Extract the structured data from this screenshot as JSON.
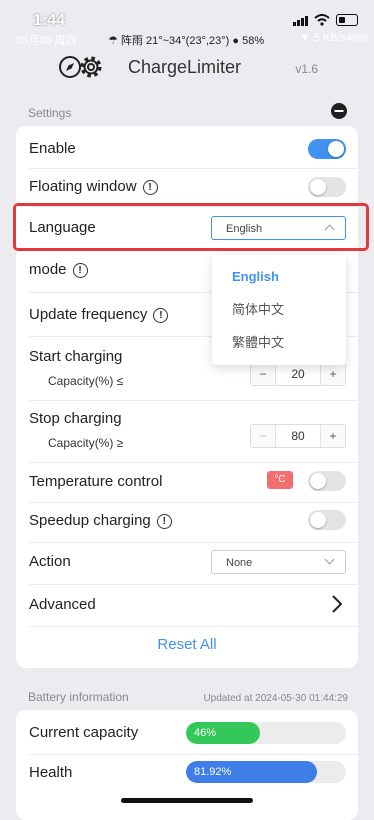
{
  "status_bar": {
    "time": "1:44",
    "date": "05月30 周四",
    "weather": "阵雨 21°~34°(23°,23°)",
    "battery_percent": "58%",
    "net_speed": "5 KB/s46%"
  },
  "header": {
    "title": "ChargeLimiter",
    "version": "v1.6"
  },
  "settings": {
    "section_label": "Settings",
    "enable": {
      "label": "Enable",
      "on": true
    },
    "floating_window": {
      "label": "Floating window",
      "on": false
    },
    "language": {
      "label": "Language",
      "value": "English"
    },
    "mode": {
      "label": "mode"
    },
    "update_frequency": {
      "label": "Update frequency"
    },
    "start_charging": {
      "label": "Start charging",
      "sub_label": "Capacity(%) ≤",
      "value": "20",
      "minus": "−",
      "plus": "+"
    },
    "stop_charging": {
      "label": "Stop charging",
      "sub_label": "Capacity(%) ≥",
      "value": "80",
      "minus": "−",
      "plus": "+"
    },
    "temperature_control": {
      "label": "Temperature control",
      "badge": "°C",
      "on": false
    },
    "speedup_charging": {
      "label": "Speedup charging",
      "on": false
    },
    "action": {
      "label": "Action",
      "value": "None"
    },
    "advanced": {
      "label": "Advanced"
    },
    "reset_all": "Reset All"
  },
  "language_dropdown": {
    "options": [
      "English",
      "简体中文",
      "繁體中文"
    ],
    "selected": "English"
  },
  "battery_info": {
    "section_label": "Battery information",
    "updated": "Updated at 2024-05-30 01:44:29",
    "current_capacity": {
      "label": "Current capacity",
      "text": "46%",
      "percent": 46
    },
    "health": {
      "label": "Health",
      "text": "81.92%",
      "percent": 81.92
    }
  },
  "colors": {
    "accent": "#3f93ee",
    "highlight": "#e03a3a",
    "capacity_bar": "#34c759",
    "health_bar": "#3f7ee8",
    "temp_badge": "#f46f6f"
  },
  "icons": [
    "compass-icon",
    "gear-icon",
    "collapse-icon",
    "info-icon",
    "chevron-right-icon",
    "chevron-down-icon",
    "chevron-up-icon"
  ]
}
